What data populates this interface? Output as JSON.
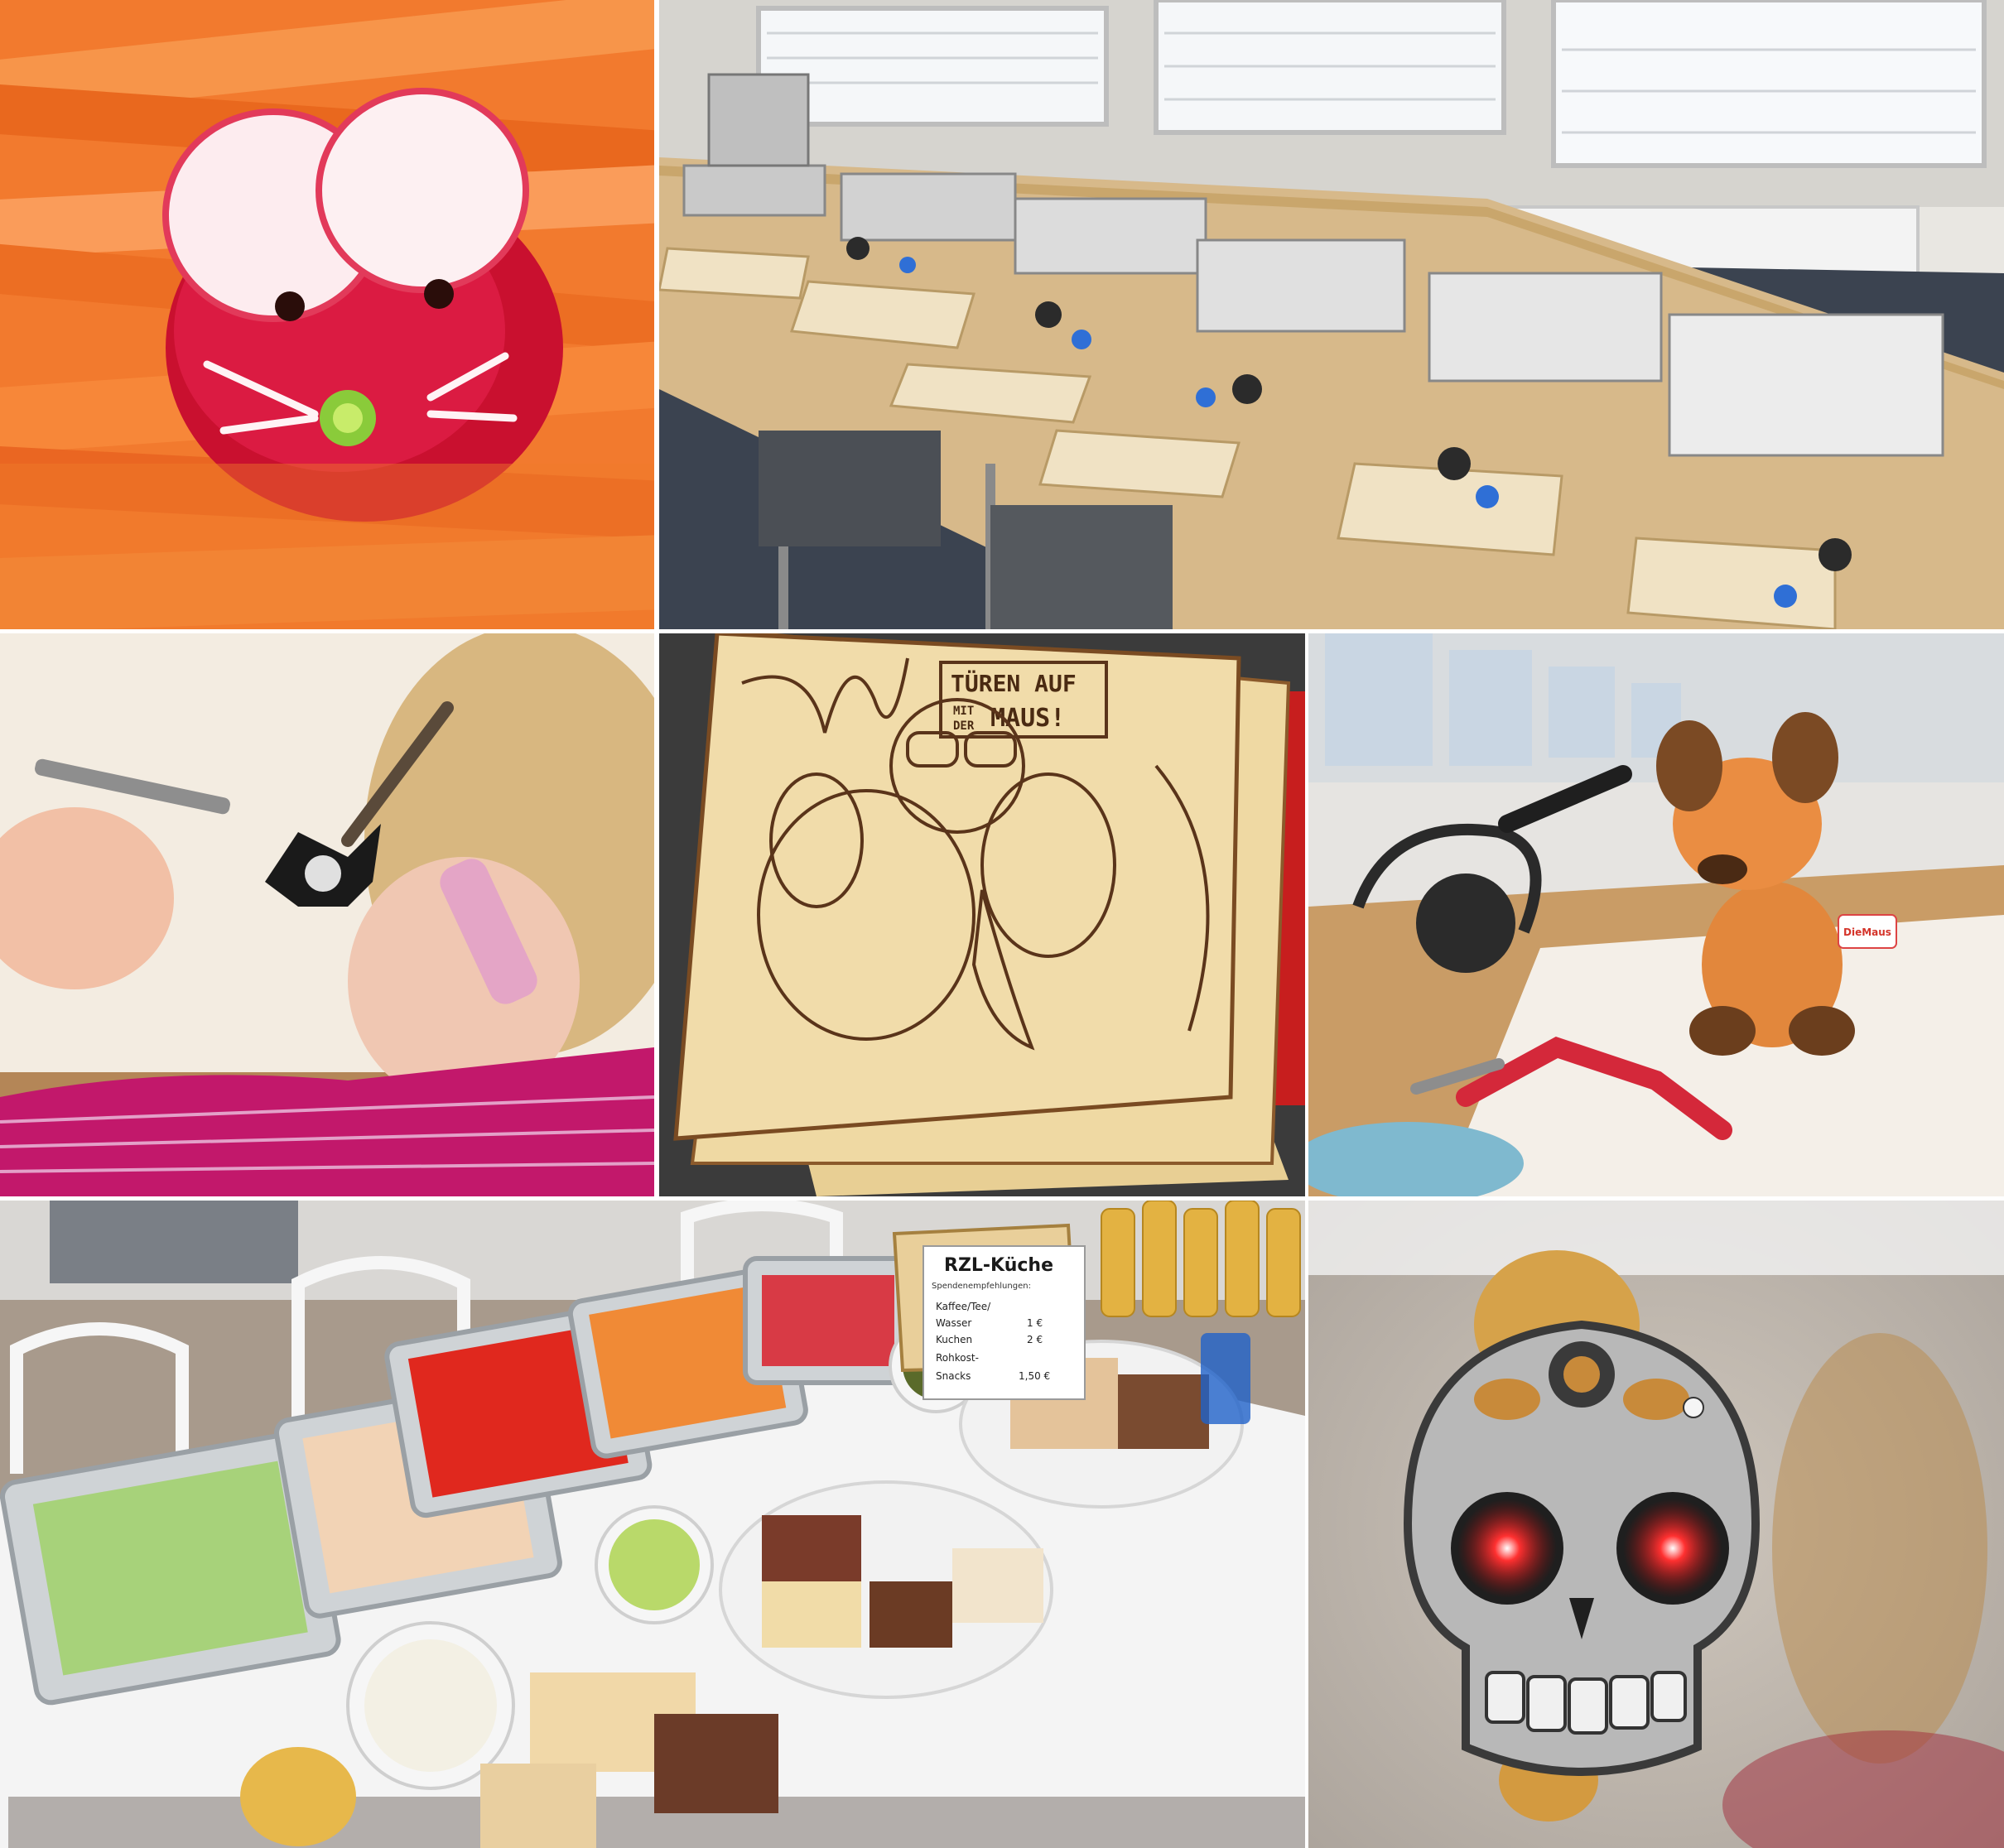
{
  "collage": {
    "tiles": [
      {
        "subject": "radish mouse on carrot sticks"
      },
      {
        "subject": "soldering workstations with tool cases"
      },
      {
        "subject": "child soldering a bat-shaped circuit board"
      },
      {
        "subject": "laser-engraved wooden boards"
      },
      {
        "subject": "plush mouse toy next to soldering iron and pliers"
      },
      {
        "subject": "buffet of vegetables, fruit and cakes"
      },
      {
        "subject": "sugar skull circuit badge with red LED eyes"
      }
    ]
  },
  "engraving": {
    "sign_line1": "TÜREN AUF",
    "sign_small1": "MIT",
    "sign_small2": "DER",
    "sign_line2": "MAUS!"
  },
  "plush": {
    "tag_text": "DieMaus"
  },
  "buffet_sign": {
    "title": "RZL-Küche",
    "subtitle": "Spendenempfehlungen:",
    "items": [
      {
        "label": "Kaffee/Tee/",
        "price": ""
      },
      {
        "label": "Wasser",
        "price": "1 €"
      },
      {
        "label": "Kuchen",
        "price": "2 €"
      },
      {
        "label": "Rohkost-",
        "price": ""
      },
      {
        "label": "Snacks",
        "price": "1,50 €"
      }
    ]
  },
  "colors": {
    "carrot": "#f07a2a",
    "radish": "#d11a3c",
    "wood": "#e6c98d",
    "led_red": "#ff2222",
    "magenta_shirt": "#c2186b"
  }
}
